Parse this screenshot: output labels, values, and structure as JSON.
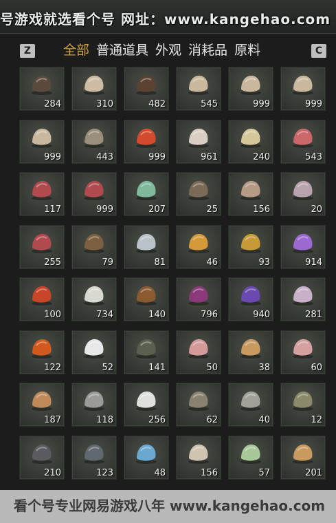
{
  "watermark_top": "号游戏就选看个号  网址：www.kangehao.com",
  "watermark_bottom": "看个号专业网易游戏八年  www.kangehao.com",
  "keys": {
    "left": "Z",
    "right": "C"
  },
  "tabs": [
    {
      "label": "全部",
      "active": true
    },
    {
      "label": "普通道具",
      "active": false
    },
    {
      "label": "外观",
      "active": false
    },
    {
      "label": "消耗品",
      "active": false
    },
    {
      "label": "原料",
      "active": false
    }
  ],
  "items": [
    {
      "icon": "feather-icon",
      "qty": "284",
      "color": "#5a4a3c"
    },
    {
      "icon": "oyster-icon",
      "qty": "310",
      "color": "#cdbca3"
    },
    {
      "icon": "cricket-icon",
      "qty": "482",
      "color": "#5b4130"
    },
    {
      "icon": "grain-sack-icon",
      "qty": "545",
      "color": "#c9b89e"
    },
    {
      "icon": "grain-sack-icon",
      "qty": "999",
      "color": "#c9b89e"
    },
    {
      "icon": "grain-sack-icon",
      "qty": "999",
      "color": "#c9b89e"
    },
    {
      "icon": "grain-sack-icon",
      "qty": "999",
      "color": "#c9b89e"
    },
    {
      "icon": "fish-icon",
      "qty": "443",
      "color": "#9a8f7a"
    },
    {
      "icon": "fruit-branch-icon",
      "qty": "999",
      "color": "#d24b2f"
    },
    {
      "icon": "mushroom-icon",
      "qty": "961",
      "color": "#d8cfc2"
    },
    {
      "icon": "eggs-icon",
      "qty": "240",
      "color": "#d4c89a"
    },
    {
      "icon": "meat-cubes-icon",
      "qty": "543",
      "color": "#c9676a"
    },
    {
      "icon": "raw-meat-icon",
      "qty": "117",
      "color": "#b04a4e"
    },
    {
      "icon": "raw-meat-icon",
      "qty": "999",
      "color": "#b04a4e"
    },
    {
      "icon": "jade-stone-icon",
      "qty": "207",
      "color": "#7fb89a"
    },
    {
      "icon": "feathers-icon",
      "qty": "25",
      "color": "#7b6a55"
    },
    {
      "icon": "hide-icon",
      "qty": "156",
      "color": "#b59a86"
    },
    {
      "icon": "fur-pelt-icon",
      "qty": "20",
      "color": "#b8a2ae"
    },
    {
      "icon": "raw-meat-icon",
      "qty": "255",
      "color": "#b04a4e"
    },
    {
      "icon": "catfish-icon",
      "qty": "79",
      "color": "#7c6040"
    },
    {
      "icon": "salmon-icon",
      "qty": "81",
      "color": "#b8c2c8"
    },
    {
      "icon": "carp-icon",
      "qty": "46",
      "color": "#d49a3a"
    },
    {
      "icon": "gold-ore-icon",
      "qty": "93",
      "color": "#c79a38"
    },
    {
      "icon": "amethyst-icon",
      "qty": "914",
      "color": "#9a6ad0"
    },
    {
      "icon": "red-gem-icon",
      "qty": "100",
      "color": "#c8452a"
    },
    {
      "icon": "white-flower-icon",
      "qty": "734",
      "color": "#d8d8d0"
    },
    {
      "icon": "herb-bowl-icon",
      "qty": "140",
      "color": "#8a5a30"
    },
    {
      "icon": "purple-flower-icon",
      "qty": "796",
      "color": "#8a3a78"
    },
    {
      "icon": "lavender-icon",
      "qty": "940",
      "color": "#6b4ab0"
    },
    {
      "icon": "blossom-sprig-icon",
      "qty": "281",
      "color": "#c8b0c8"
    },
    {
      "icon": "orange-flower-icon",
      "qty": "122",
      "color": "#d25a1e"
    },
    {
      "icon": "white-feather-icon",
      "qty": "52",
      "color": "#e8e8e8"
    },
    {
      "icon": "pine-branch-icon",
      "qty": "141",
      "color": "#5a6050"
    },
    {
      "icon": "meat-slice-icon",
      "qty": "50",
      "color": "#d49a9a"
    },
    {
      "icon": "soup-bowl-icon",
      "qty": "38",
      "color": "#c89a60"
    },
    {
      "icon": "meat-slice-icon",
      "qty": "60",
      "color": "#d4a0a0"
    },
    {
      "icon": "wool-icon",
      "qty": "187",
      "color": "#c08a58"
    },
    {
      "icon": "quills-icon",
      "qty": "118",
      "color": "#9a9a98"
    },
    {
      "icon": "white-fur-icon",
      "qty": "256",
      "color": "#e0e0dc"
    },
    {
      "icon": "rockfish-icon",
      "qty": "62",
      "color": "#8a8270"
    },
    {
      "icon": "grey-fish-icon",
      "qty": "40",
      "color": "#a0a098"
    },
    {
      "icon": "grouper-icon",
      "qty": "12",
      "color": "#8a8a6a"
    },
    {
      "icon": "dark-ore-icon",
      "qty": "210",
      "color": "#5a5a60"
    },
    {
      "icon": "dark-ore-icon",
      "qty": "123",
      "color": "#606870"
    },
    {
      "icon": "blue-ore-icon",
      "qty": "48",
      "color": "#6aa8d0"
    },
    {
      "icon": "bone-icon",
      "qty": "156",
      "color": "#cfc4b0"
    },
    {
      "icon": "melon-icon",
      "qty": "57",
      "color": "#a8c89a"
    },
    {
      "icon": "bundle-icon",
      "qty": "201",
      "color": "#c89a60"
    }
  ]
}
